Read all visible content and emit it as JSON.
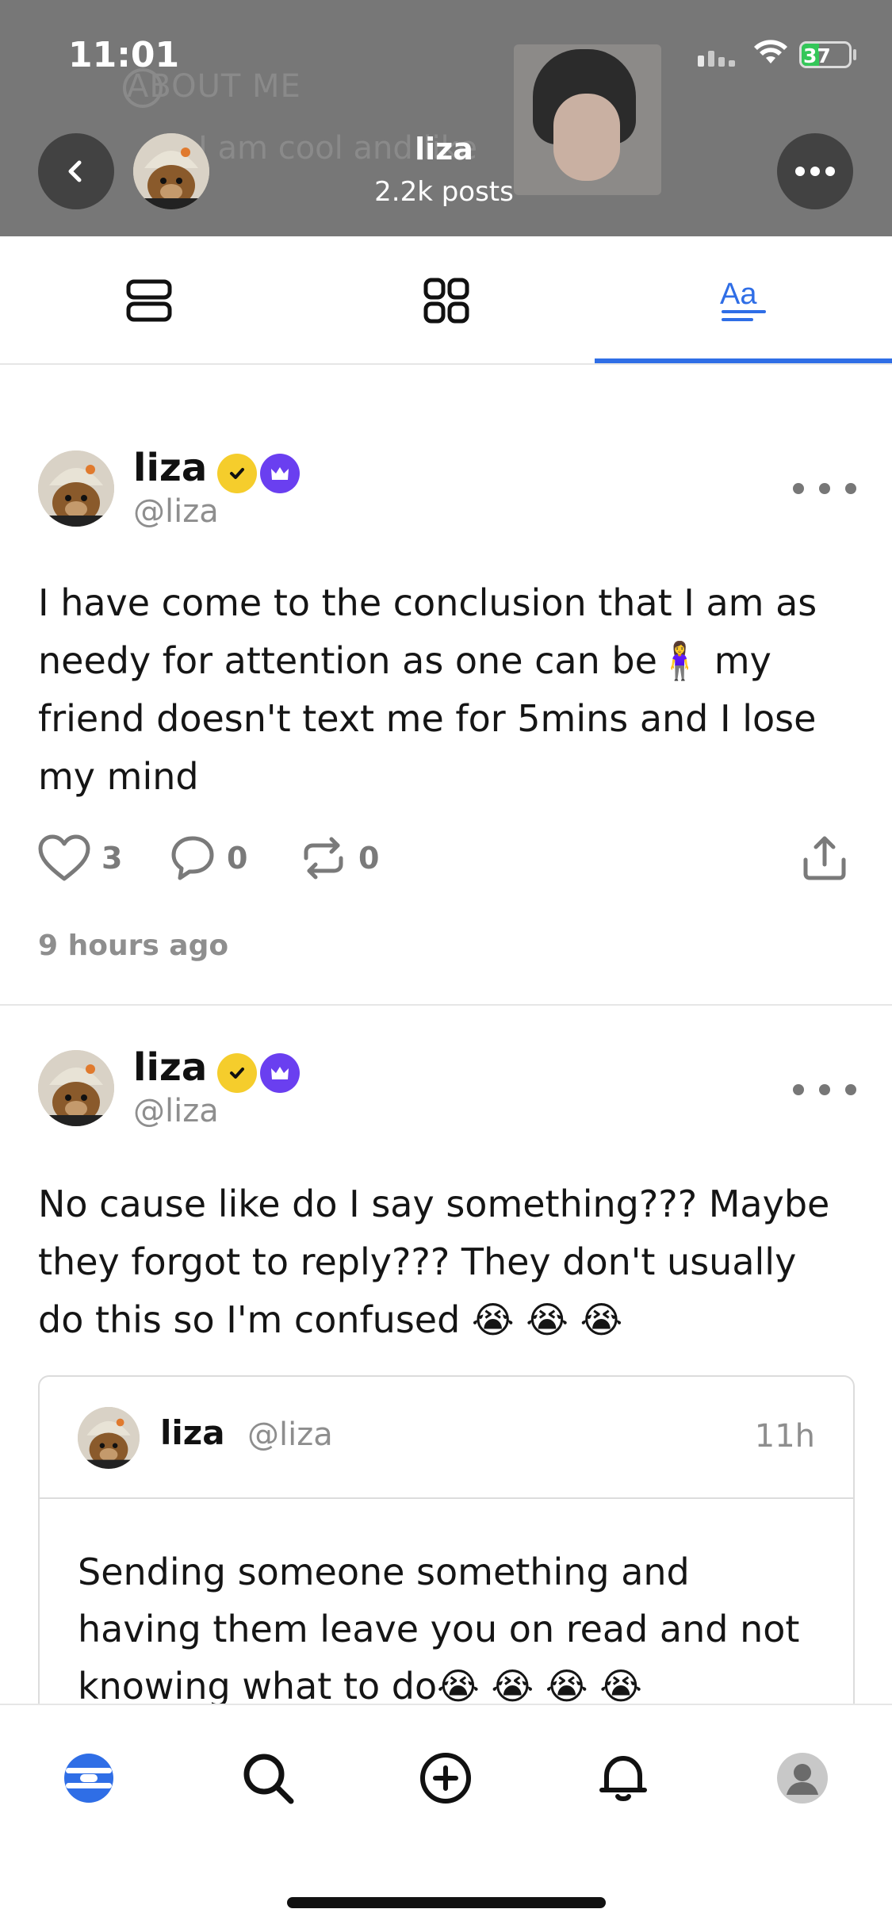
{
  "status_bar": {
    "time": "11:01",
    "battery": "37",
    "battery_level": 0.37
  },
  "header": {
    "background_title": "ABOUT ME",
    "background_text": "I am cool and like",
    "name": "liza",
    "posts": "2.2k posts"
  },
  "tabs": [
    {
      "name": "list-view",
      "active": false
    },
    {
      "name": "grid-view",
      "active": false
    },
    {
      "name": "text-view",
      "active": true
    }
  ],
  "posts": [
    {
      "name": "liza",
      "handle": "@liza",
      "text": "I have come to the conclusion that I am as needy for attention as one can be🧍‍♀️ my friend doesn't text me for 5mins and I lose my mind",
      "likes": "3",
      "comments": "0",
      "reposts": "0",
      "time": "9 hours ago"
    },
    {
      "name": "liza",
      "handle": "@liza",
      "text": "No cause like do I say something??? Maybe they forgot to reply??? They don't usually do this so I'm confused 😭 😭 😭",
      "quote": {
        "name": "liza",
        "handle": "@liza",
        "time": "11h",
        "text": "Sending someone something and having them leave you on read and not knowing what to do😭 😭 😭 😭"
      }
    }
  ],
  "colors": {
    "accent": "#2f6ee6",
    "verified": "#f5cd2c",
    "crown": "#6a3ff0",
    "header_bg": "#777777"
  },
  "bottom_nav": [
    "home-icon",
    "search-icon",
    "create-icon",
    "notifications-icon",
    "profile-icon"
  ]
}
